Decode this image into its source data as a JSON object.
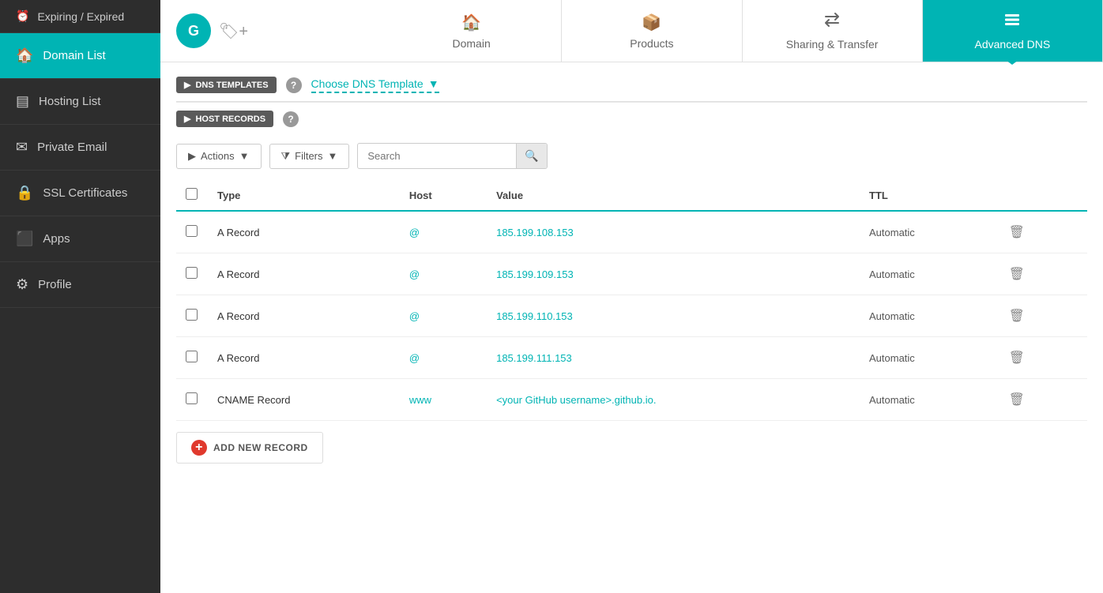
{
  "sidebar": {
    "items": [
      {
        "id": "expiring-expired",
        "label": "Expiring / Expired",
        "icon": "⏰",
        "active": false
      },
      {
        "id": "domain-list",
        "label": "Domain List",
        "icon": "🏠",
        "active": true
      },
      {
        "id": "hosting-list",
        "label": "Hosting List",
        "icon": "☰",
        "active": false
      },
      {
        "id": "private-email",
        "label": "Private Email",
        "icon": "✉",
        "active": false
      },
      {
        "id": "ssl-certificates",
        "label": "SSL Certificates",
        "icon": "🔒",
        "active": false
      },
      {
        "id": "apps",
        "label": "Apps",
        "icon": "⬛",
        "active": false
      },
      {
        "id": "profile",
        "label": "Profile",
        "icon": "⚙",
        "active": false
      }
    ]
  },
  "tabs": [
    {
      "id": "domain",
      "label": "Domain",
      "icon": "🏠",
      "active": false
    },
    {
      "id": "products",
      "label": "Products",
      "icon": "📦",
      "active": false
    },
    {
      "id": "sharing-transfer",
      "label": "Sharing & Transfer",
      "icon": "🔀",
      "active": false
    },
    {
      "id": "advanced-dns",
      "label": "Advanced DNS",
      "icon": "☰",
      "active": true
    }
  ],
  "dns_templates": {
    "section_label": "DNS TEMPLATES",
    "help_tooltip": "?",
    "dropdown_placeholder": "Choose DNS Template",
    "dropdown_arrow": "▼"
  },
  "host_records": {
    "section_label": "HOST RECORDS",
    "help_tooltip": "?"
  },
  "toolbar": {
    "actions_label": "Actions",
    "filters_label": "Filters",
    "search_placeholder": "Search"
  },
  "table": {
    "headers": [
      "",
      "Type",
      "Host",
      "Value",
      "TTL",
      ""
    ],
    "rows": [
      {
        "type": "A Record",
        "host": "@",
        "value": "185.199.108.153",
        "ttl": "Automatic"
      },
      {
        "type": "A Record",
        "host": "@",
        "value": "185.199.109.153",
        "ttl": "Automatic"
      },
      {
        "type": "A Record",
        "host": "@",
        "value": "185.199.110.153",
        "ttl": "Automatic"
      },
      {
        "type": "A Record",
        "host": "@",
        "value": "185.199.111.153",
        "ttl": "Automatic"
      },
      {
        "type": "CNAME Record",
        "host": "www",
        "value": "<your GitHub username>.github.io.",
        "ttl": "Automatic"
      }
    ]
  },
  "add_record": {
    "label": "ADD NEW RECORD"
  },
  "colors": {
    "accent": "#00b4b4",
    "sidebar_bg": "#2d2d2d",
    "active_sidebar": "#00b4b4",
    "danger": "#e0392d"
  }
}
